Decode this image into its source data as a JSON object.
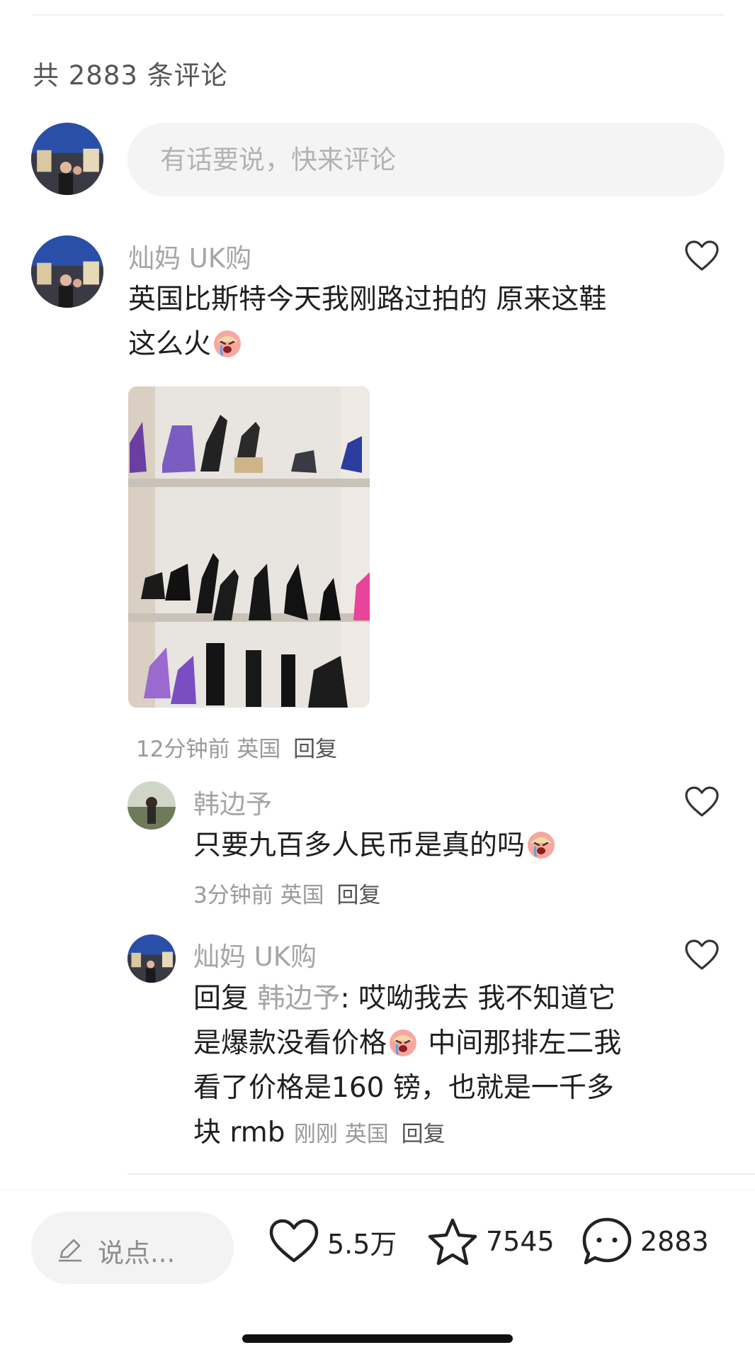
{
  "comment_count_label": "共 2883 条评论",
  "input": {
    "placeholder": "有话要说，快来评论"
  },
  "main_comment": {
    "username": "灿妈 UK购",
    "text_line1": "英国比斯特今天我刚路过拍的 原来这鞋",
    "text_line2": "这么火",
    "emoji": "crying-face-emoji",
    "time": "12分钟前",
    "location": "英国",
    "reply_label": "回复"
  },
  "reply1": {
    "username": "韩边予",
    "text": "只要九百多人民币是真的吗",
    "emoji": "crying-face-emoji",
    "time": "3分钟前",
    "location": "英国",
    "reply_label": "回复"
  },
  "reply2": {
    "username": "灿妈 UK购",
    "reply_prefix": "回复",
    "reply_to": "韩边予",
    "text_part1": ": 哎呦我去 我不知道它",
    "text_part2": "是爆款没看价格",
    "text_part3": " 中间那排左二我",
    "text_part4": "看了价格是160 镑，也就是一千多",
    "text_part5": "块 rmb",
    "time": "刚刚",
    "location": "英国",
    "reply_label": "回复"
  },
  "bottom_bar": {
    "say_label": "说点...",
    "likes": "5.5万",
    "favorites": "7545",
    "comments": "2883"
  },
  "colors": {
    "muted": "#9a9a9a",
    "text": "#1f1f1f",
    "pill": "#f4f4f4"
  }
}
